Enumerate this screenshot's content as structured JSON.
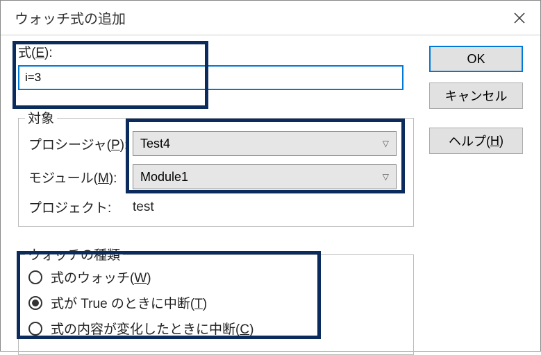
{
  "titlebar": {
    "title": "ウォッチ式の追加"
  },
  "buttons": {
    "ok": "OK",
    "cancel": "キャンセル",
    "help_pre": "ヘルプ(",
    "help_key": "H",
    "help_post": ")"
  },
  "expression": {
    "label_pre": "式(",
    "label_key": "E",
    "label_post": "):",
    "value": "i=3"
  },
  "context": {
    "group_label": "対象",
    "procedure": {
      "label_pre": "プロシージャ(",
      "label_key": "P",
      "label_post": "):",
      "value": "Test4"
    },
    "module": {
      "label_pre": "モジュール(",
      "label_key": "M",
      "label_post": "):",
      "value": "Module1"
    },
    "project": {
      "label": "プロジェクト:",
      "value": "test"
    }
  },
  "watch_type": {
    "group_label": "ウォッチの種類",
    "options": [
      {
        "label_pre": "式のウォッチ(",
        "label_key": "W",
        "label_post": ")",
        "checked": false
      },
      {
        "label_pre": "式が True のときに中断(",
        "label_key": "T",
        "label_post": ")",
        "checked": true
      },
      {
        "label_pre": "式の内容が変化したときに中断(",
        "label_key": "C",
        "label_post": ")",
        "checked": false
      }
    ]
  }
}
